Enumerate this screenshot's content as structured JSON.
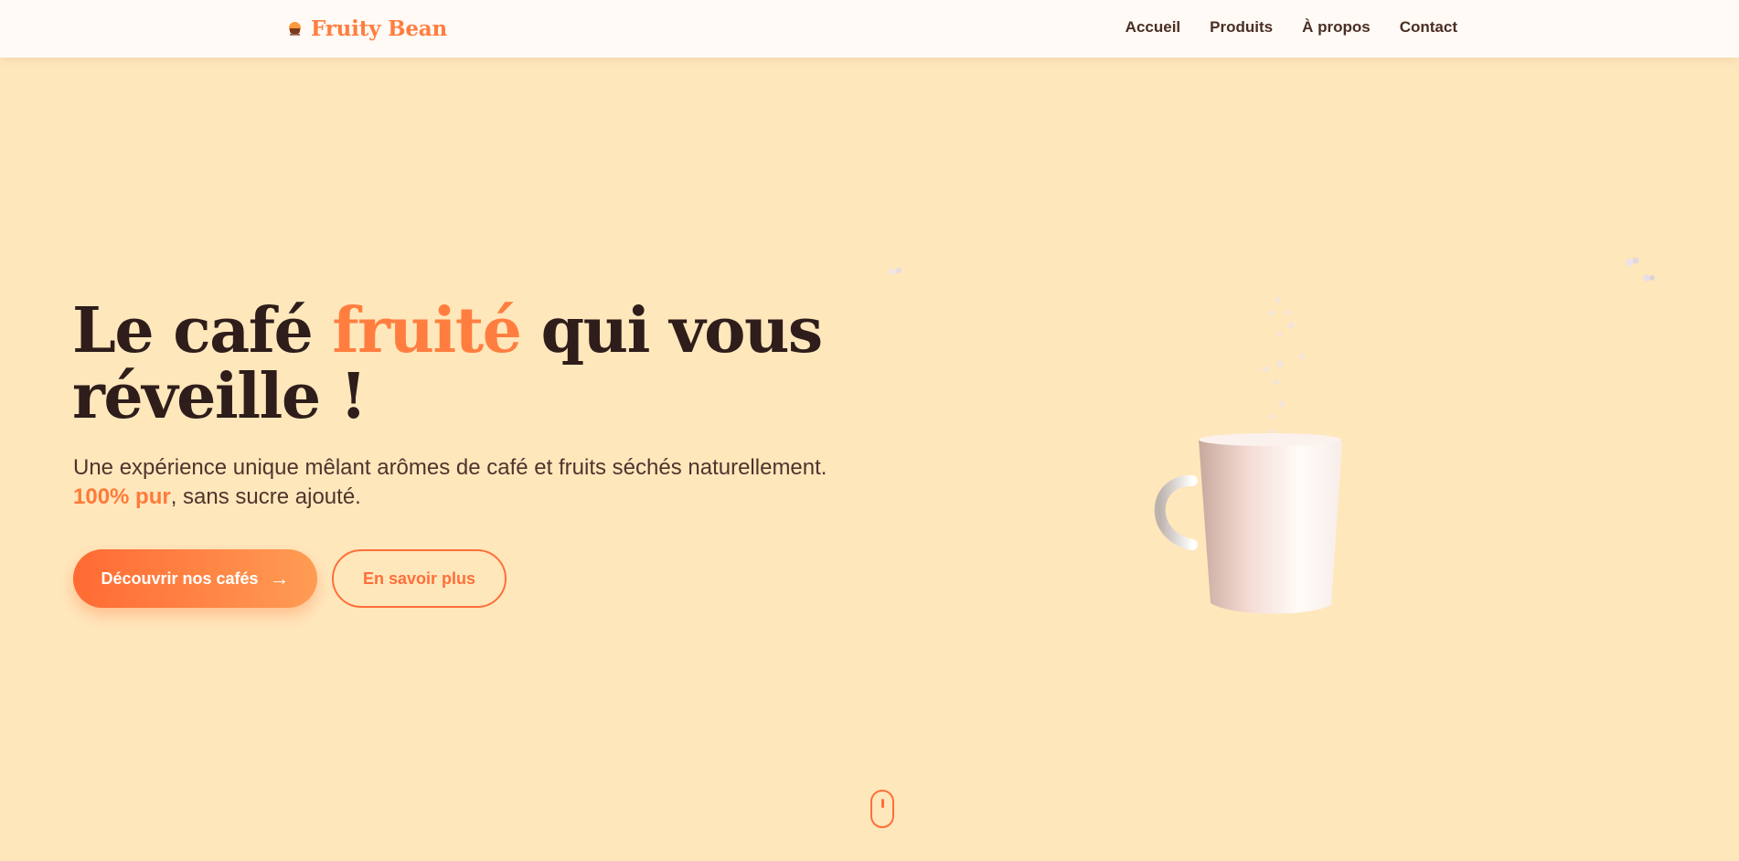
{
  "nav": {
    "brand": "Fruity Bean",
    "links": [
      "Accueil",
      "Produits",
      "À propos",
      "Contact"
    ]
  },
  "hero": {
    "title_part1": "Le café ",
    "title_accent": "fruité",
    "title_part2": " qui vous réveille !",
    "desc_line1": "Une expérience unique mêlant arômes de café et fruits séchés naturellement.",
    "desc_pure": "100% pur",
    "desc_rest": ", sans sucre ajouté.",
    "primary_button": "Découvrir nos cafés",
    "primary_arrow": "→",
    "secondary_button": "En savoir plus"
  },
  "icons": {
    "brand_logo": "coffee-cup-logo-icon",
    "mug": "coffee-mug-illustration",
    "scroll": "mouse-scroll-icon"
  },
  "colors": {
    "background": "#ffe7bc",
    "accent": "#ff7e3f",
    "dark_text": "#2e1d1a",
    "navbar": "#fffaf5"
  }
}
